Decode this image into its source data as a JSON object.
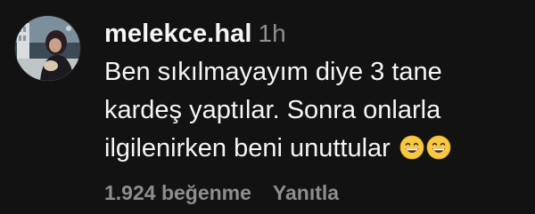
{
  "comment": {
    "avatar_icon": "profile-photo",
    "username": "melekce.hal",
    "time": "1h",
    "text_lines": [
      "Ben sıkılmayayım diye 3 tane",
      "kardeş yaptılar. Sonra onlarla",
      "ilgilenirken beni unuttular"
    ],
    "emojis": [
      "grinning-face-with-smiling-eyes",
      "grinning-face-with-smiling-eyes"
    ],
    "likes": "1.924 beğenme",
    "reply_label": "Yanıtla"
  },
  "colors": {
    "background": "#121212",
    "primary_text": "#f5f5f5",
    "secondary_text": "#8e8e8e",
    "emoji_face": "#f7c843"
  }
}
